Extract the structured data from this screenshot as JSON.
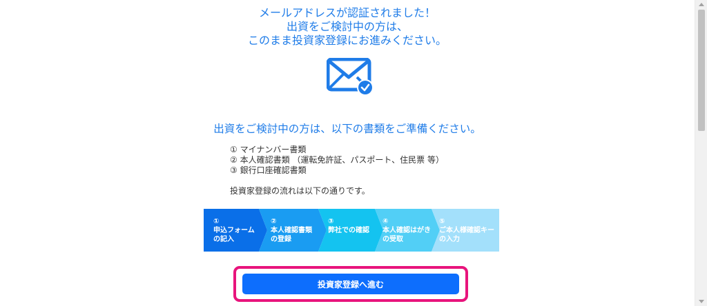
{
  "headline": {
    "line1": "メールアドレスが認証されました！",
    "line2": "出資をご検討中の方は、",
    "line3": "このまま投資家登録にお進みください。"
  },
  "icons": {
    "mail": "mail-verified-icon"
  },
  "subheading": "出資をご検討中の方は、以下の書類をご準備ください。",
  "documents": [
    "① マイナンバー書類",
    "② 本人確認書類 （運転免許証、パスポート、住民票 等）",
    "③ 銀行口座確認書類"
  ],
  "flow_intro": "投資家登録の流れは以下の通りです。",
  "flow_steps": [
    {
      "number": "①",
      "line1": "申込フォーム",
      "line2": "の記入",
      "color": "#0a6fe8"
    },
    {
      "number": "②",
      "line1": "本人確認書類",
      "line2": "の登録",
      "color": "#1a9cf2"
    },
    {
      "number": "③",
      "line1": "弊社での確認",
      "line2": "",
      "color": "#14c3f0"
    },
    {
      "number": "④",
      "line1": "本人確認はがき",
      "line2": "の受取",
      "color": "#52cff6"
    },
    {
      "number": "⑤",
      "line1": "ご本人様確認キー",
      "line2": "の入力",
      "color": "#a3e0fb"
    }
  ],
  "cta": {
    "label": "投資家登録へ進む"
  },
  "colors": {
    "accent": "#1f7ce8",
    "button": "#0d6efd",
    "highlight": "#e8147c"
  }
}
